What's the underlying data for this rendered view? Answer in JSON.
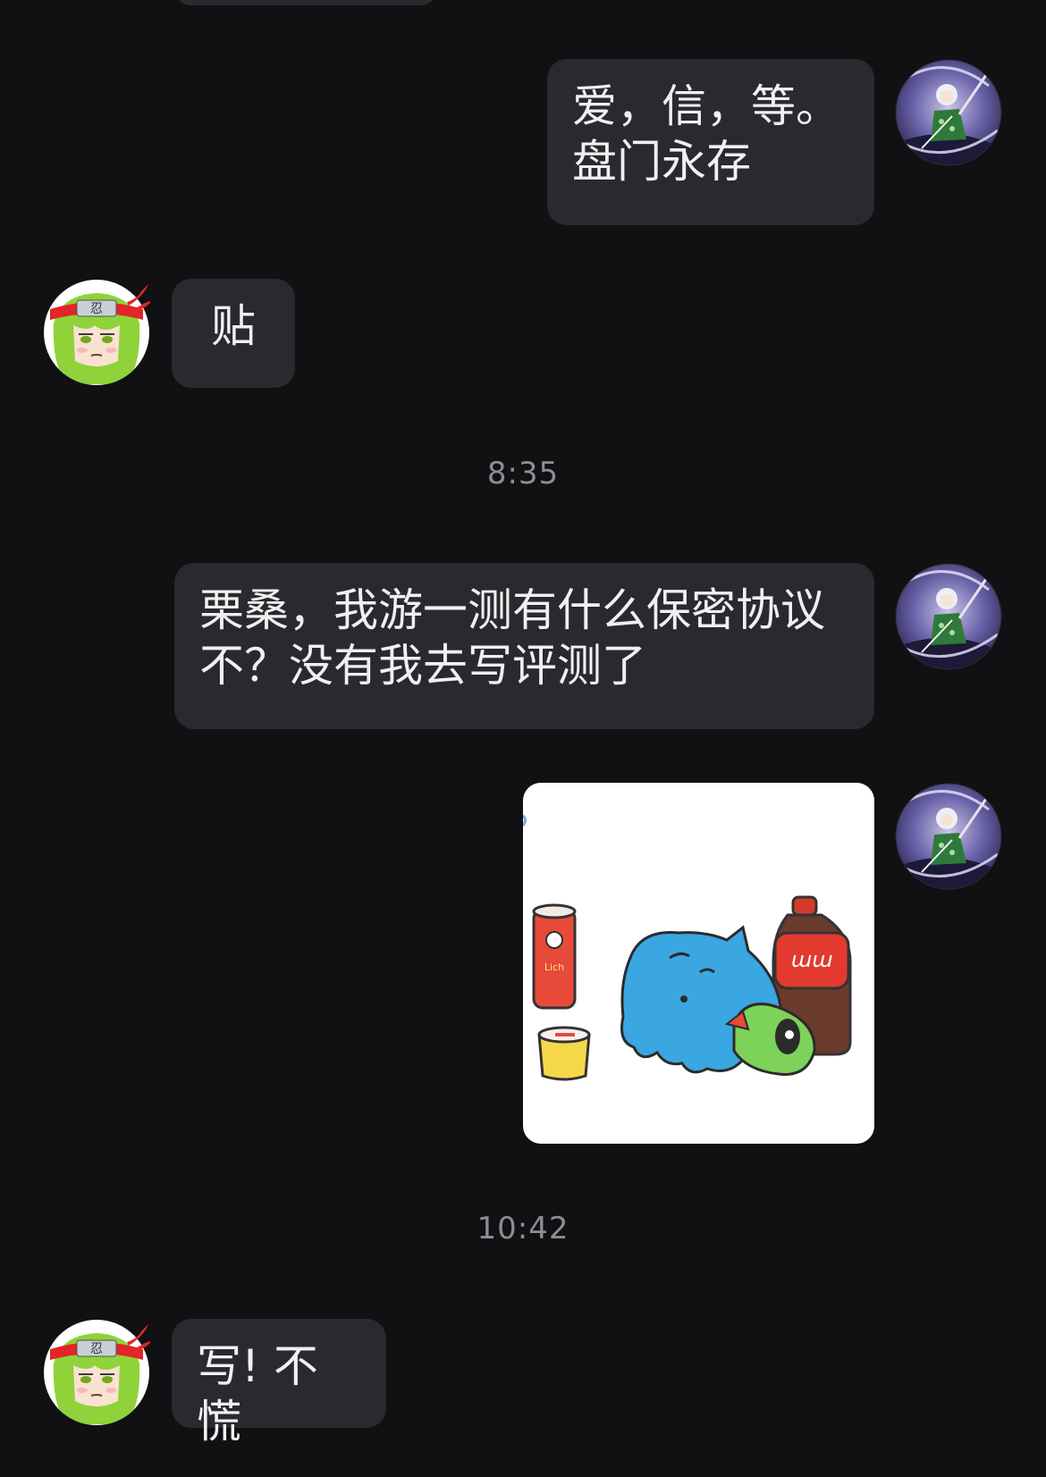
{
  "messages": [
    {
      "id": "m1",
      "sender": "self",
      "text": "爱，信，等。\n盘门永存"
    },
    {
      "id": "m2",
      "sender": "other",
      "text": "贴"
    },
    {
      "id": "m3",
      "sender": "self",
      "text": "栗桑，我游一测有什么保密协议\n不？没有我去写评测了"
    },
    {
      "id": "m4",
      "sender": "self",
      "type": "sticker",
      "sticker": "blue-cat-snacks-sticker",
      "sticker_labels": {
        "can": "Lich",
        "bottle": "ɯɯ"
      }
    },
    {
      "id": "m5",
      "sender": "other",
      "text": "写! 不慌"
    }
  ],
  "timestamps": [
    "8:35",
    "10:42"
  ],
  "avatars": {
    "self": "silver-haired-swordgirl-avatar",
    "other": "green-haired-ninja-girl-avatar"
  },
  "colors": {
    "background": "#111114",
    "bubble": "#2a2a2e",
    "text": "#f0f0f2",
    "timestamp": "#8d8d93"
  }
}
